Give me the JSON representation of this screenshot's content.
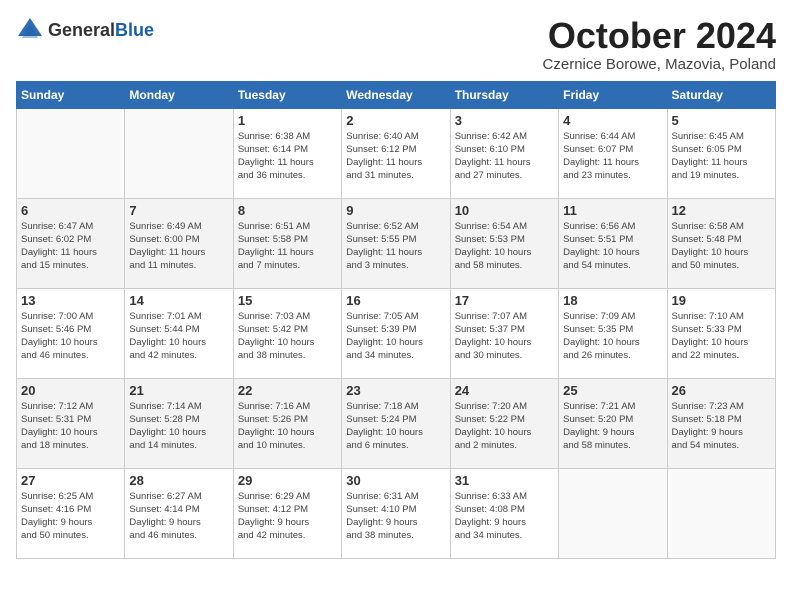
{
  "logo": {
    "text_general": "General",
    "text_blue": "Blue"
  },
  "title": "October 2024",
  "subtitle": "Czernice Borowe, Mazovia, Poland",
  "weekdays": [
    "Sunday",
    "Monday",
    "Tuesday",
    "Wednesday",
    "Thursday",
    "Friday",
    "Saturday"
  ],
  "weeks": [
    [
      {
        "day": "",
        "info": ""
      },
      {
        "day": "",
        "info": ""
      },
      {
        "day": "1",
        "info": "Sunrise: 6:38 AM\nSunset: 6:14 PM\nDaylight: 11 hours\nand 36 minutes."
      },
      {
        "day": "2",
        "info": "Sunrise: 6:40 AM\nSunset: 6:12 PM\nDaylight: 11 hours\nand 31 minutes."
      },
      {
        "day": "3",
        "info": "Sunrise: 6:42 AM\nSunset: 6:10 PM\nDaylight: 11 hours\nand 27 minutes."
      },
      {
        "day": "4",
        "info": "Sunrise: 6:44 AM\nSunset: 6:07 PM\nDaylight: 11 hours\nand 23 minutes."
      },
      {
        "day": "5",
        "info": "Sunrise: 6:45 AM\nSunset: 6:05 PM\nDaylight: 11 hours\nand 19 minutes."
      }
    ],
    [
      {
        "day": "6",
        "info": "Sunrise: 6:47 AM\nSunset: 6:02 PM\nDaylight: 11 hours\nand 15 minutes."
      },
      {
        "day": "7",
        "info": "Sunrise: 6:49 AM\nSunset: 6:00 PM\nDaylight: 11 hours\nand 11 minutes."
      },
      {
        "day": "8",
        "info": "Sunrise: 6:51 AM\nSunset: 5:58 PM\nDaylight: 11 hours\nand 7 minutes."
      },
      {
        "day": "9",
        "info": "Sunrise: 6:52 AM\nSunset: 5:55 PM\nDaylight: 11 hours\nand 3 minutes."
      },
      {
        "day": "10",
        "info": "Sunrise: 6:54 AM\nSunset: 5:53 PM\nDaylight: 10 hours\nand 58 minutes."
      },
      {
        "day": "11",
        "info": "Sunrise: 6:56 AM\nSunset: 5:51 PM\nDaylight: 10 hours\nand 54 minutes."
      },
      {
        "day": "12",
        "info": "Sunrise: 6:58 AM\nSunset: 5:48 PM\nDaylight: 10 hours\nand 50 minutes."
      }
    ],
    [
      {
        "day": "13",
        "info": "Sunrise: 7:00 AM\nSunset: 5:46 PM\nDaylight: 10 hours\nand 46 minutes."
      },
      {
        "day": "14",
        "info": "Sunrise: 7:01 AM\nSunset: 5:44 PM\nDaylight: 10 hours\nand 42 minutes."
      },
      {
        "day": "15",
        "info": "Sunrise: 7:03 AM\nSunset: 5:42 PM\nDaylight: 10 hours\nand 38 minutes."
      },
      {
        "day": "16",
        "info": "Sunrise: 7:05 AM\nSunset: 5:39 PM\nDaylight: 10 hours\nand 34 minutes."
      },
      {
        "day": "17",
        "info": "Sunrise: 7:07 AM\nSunset: 5:37 PM\nDaylight: 10 hours\nand 30 minutes."
      },
      {
        "day": "18",
        "info": "Sunrise: 7:09 AM\nSunset: 5:35 PM\nDaylight: 10 hours\nand 26 minutes."
      },
      {
        "day": "19",
        "info": "Sunrise: 7:10 AM\nSunset: 5:33 PM\nDaylight: 10 hours\nand 22 minutes."
      }
    ],
    [
      {
        "day": "20",
        "info": "Sunrise: 7:12 AM\nSunset: 5:31 PM\nDaylight: 10 hours\nand 18 minutes."
      },
      {
        "day": "21",
        "info": "Sunrise: 7:14 AM\nSunset: 5:28 PM\nDaylight: 10 hours\nand 14 minutes."
      },
      {
        "day": "22",
        "info": "Sunrise: 7:16 AM\nSunset: 5:26 PM\nDaylight: 10 hours\nand 10 minutes."
      },
      {
        "day": "23",
        "info": "Sunrise: 7:18 AM\nSunset: 5:24 PM\nDaylight: 10 hours\nand 6 minutes."
      },
      {
        "day": "24",
        "info": "Sunrise: 7:20 AM\nSunset: 5:22 PM\nDaylight: 10 hours\nand 2 minutes."
      },
      {
        "day": "25",
        "info": "Sunrise: 7:21 AM\nSunset: 5:20 PM\nDaylight: 9 hours\nand 58 minutes."
      },
      {
        "day": "26",
        "info": "Sunrise: 7:23 AM\nSunset: 5:18 PM\nDaylight: 9 hours\nand 54 minutes."
      }
    ],
    [
      {
        "day": "27",
        "info": "Sunrise: 6:25 AM\nSunset: 4:16 PM\nDaylight: 9 hours\nand 50 minutes."
      },
      {
        "day": "28",
        "info": "Sunrise: 6:27 AM\nSunset: 4:14 PM\nDaylight: 9 hours\nand 46 minutes."
      },
      {
        "day": "29",
        "info": "Sunrise: 6:29 AM\nSunset: 4:12 PM\nDaylight: 9 hours\nand 42 minutes."
      },
      {
        "day": "30",
        "info": "Sunrise: 6:31 AM\nSunset: 4:10 PM\nDaylight: 9 hours\nand 38 minutes."
      },
      {
        "day": "31",
        "info": "Sunrise: 6:33 AM\nSunset: 4:08 PM\nDaylight: 9 hours\nand 34 minutes."
      },
      {
        "day": "",
        "info": ""
      },
      {
        "day": "",
        "info": ""
      }
    ]
  ]
}
